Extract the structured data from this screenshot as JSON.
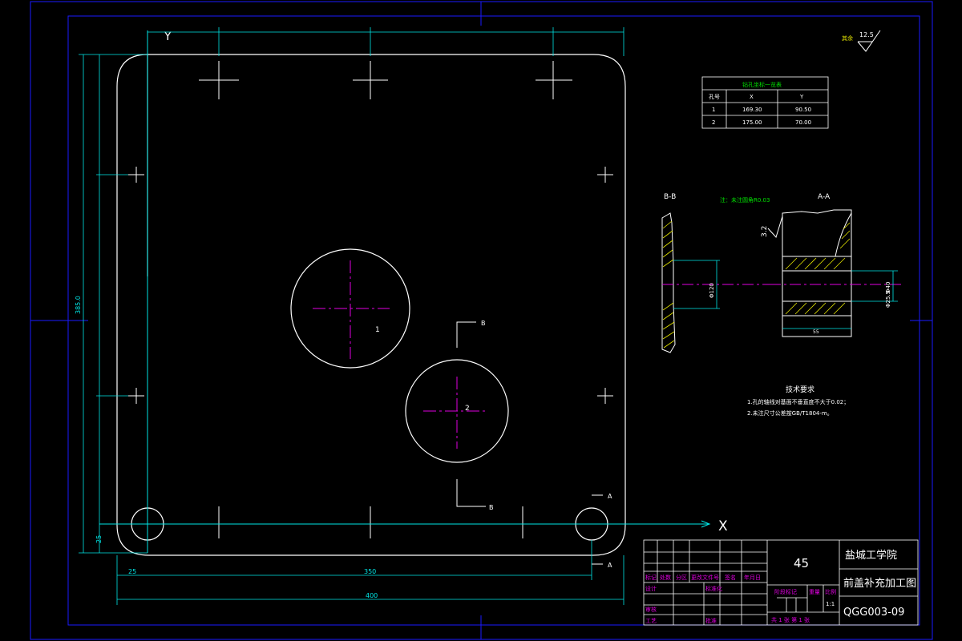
{
  "colors": {
    "background": "#000000",
    "border": "#1a1aff",
    "part": "#ffffff",
    "dimension": "#00e5e5",
    "centerline": "#e000e0",
    "hatch": "#e6e600",
    "note": "#00e000",
    "titleblock": "#ffffff",
    "label": "#e000e0"
  },
  "axes": {
    "x": "X",
    "y": "Y"
  },
  "dimensions": {
    "width_350": "350",
    "width_400": "400",
    "offset_25": "25",
    "height": "385.0",
    "height_25": "25"
  },
  "holes": {
    "hole_1": "1",
    "hole_2": "2"
  },
  "section_marks": {
    "a_top": "A",
    "a_bottom": "A",
    "b_top": "B",
    "b_bottom": "B"
  },
  "roughness": {
    "label": "其余",
    "value": "12.5"
  },
  "coord_table": {
    "title": "钻孔坐标一览表",
    "headers": [
      "孔号",
      "X",
      "Y"
    ],
    "rows": [
      [
        "1",
        "169.30",
        "90.50"
      ],
      [
        "2",
        "175.00",
        "70.00"
      ]
    ]
  },
  "views": {
    "bb": {
      "title": "B-B",
      "dim": "Φ120"
    },
    "aa": {
      "title": "A-A",
      "dim_left": "Φ40",
      "dim_right": "Φ25.5",
      "dim_bottom": "55",
      "roughness": "3.2"
    },
    "note": "注：未注圆角R0.03"
  },
  "tech": {
    "title": "技术要求",
    "lines": [
      "1.孔的轴线对基面不垂直度不大于0.02；",
      "2.未注尺寸公差按GB/T1804-m。"
    ]
  },
  "titleblock": {
    "material": "45",
    "school": "盐城工学院",
    "part_name": "前盖补充加工图",
    "drawing_no": "QGG003-09",
    "scale": "1:1",
    "sheets": "共 1 张  第 1 张",
    "labels": {
      "mark": "标记",
      "count": "处数",
      "zone": "分区",
      "doc": "更改文件号",
      "sign": "签名",
      "date": "年月日",
      "design": "设计",
      "standard": "标准化",
      "review": "审核",
      "process": "工艺",
      "approve": "批准",
      "stage": "阶段标记",
      "weight": "重量",
      "ratio": "比例"
    }
  }
}
